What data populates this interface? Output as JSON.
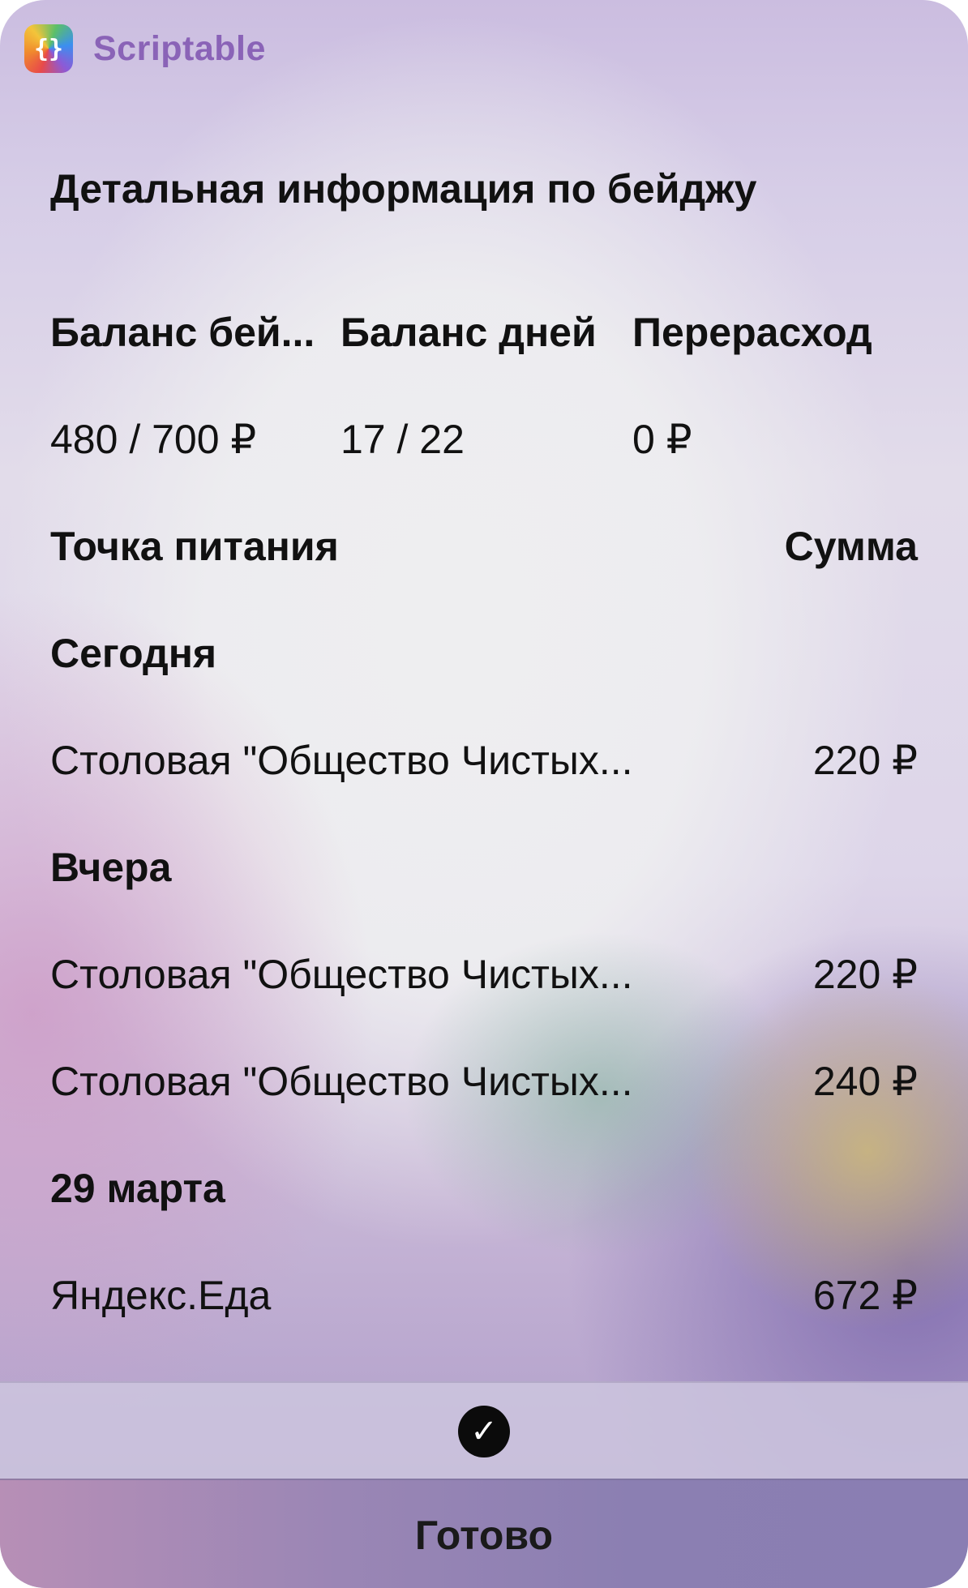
{
  "app": {
    "name": "Scriptable",
    "icon": "curly-braces-icon",
    "icon_glyph": "{}"
  },
  "title": "Детальная информация по бейджу",
  "summary": {
    "headers": [
      "Баланс бей...",
      "Баланс дней",
      "Перерасход"
    ],
    "values": [
      "480 / 700 ₽",
      "17 / 22",
      "0 ₽"
    ]
  },
  "table": {
    "col_place": "Точка питания",
    "col_sum": "Сумма"
  },
  "groups": [
    {
      "date": "Сегодня",
      "items": [
        {
          "place": "Столовая \"Общество Чистых...",
          "sum": "220 ₽"
        }
      ]
    },
    {
      "date": "Вчера",
      "items": [
        {
          "place": "Столовая \"Общество Чистых...",
          "sum": "220 ₽"
        },
        {
          "place": "Столовая \"Общество Чистых...",
          "sum": "240 ₽"
        }
      ]
    },
    {
      "date": "29 марта",
      "items": [
        {
          "place": "Яндекс.Еда",
          "sum": "672 ₽"
        }
      ]
    }
  ],
  "actions": {
    "check_icon": "checkmark-circle-icon",
    "check_glyph": "✓",
    "done_label": "Готово"
  }
}
